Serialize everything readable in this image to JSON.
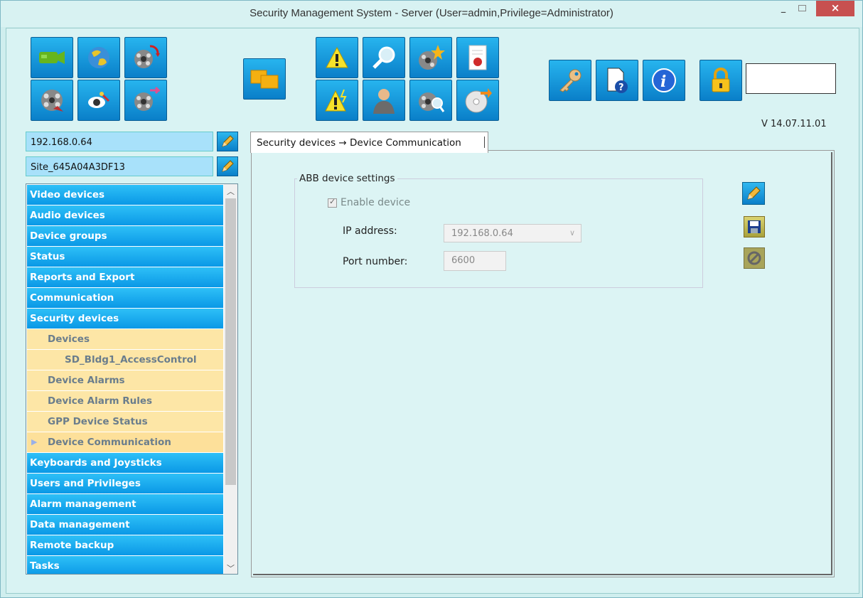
{
  "window": {
    "title": "Security Management System - Server (User=admin,Privilege=Administrator)",
    "min_glyph": "–",
    "close_glyph": "×"
  },
  "toolbar": {
    "icons": [
      "camera-icon",
      "globe-icon",
      "film-refresh-icon",
      "film-reel-icon",
      "eye-icon",
      "film-send-icon",
      "windows-icon",
      "warning-icon",
      "search-icon",
      "film-star-icon",
      "report-icon",
      "warning-flash-icon",
      "user-icon",
      "film-search-icon",
      "disc-export-icon",
      "key-icon",
      "help-doc-icon",
      "info-icon",
      "lock-icon"
    ],
    "lock_field_value": ""
  },
  "version": "V 14.07.11.01",
  "server": {
    "ip": "192.168.0.64",
    "site": "Site_645A04A3DF13"
  },
  "nav": {
    "items": [
      {
        "label": "Video devices",
        "level": 0
      },
      {
        "label": "Audio devices",
        "level": 0
      },
      {
        "label": "Device groups",
        "level": 0
      },
      {
        "label": "Status",
        "level": 0
      },
      {
        "label": "Reports and Export",
        "level": 0
      },
      {
        "label": "Communication",
        "level": 0
      },
      {
        "label": "Security devices",
        "level": 0
      },
      {
        "label": "Devices",
        "level": 1
      },
      {
        "label": "SD_Bldg1_AccessControl",
        "level": 2
      },
      {
        "label": "Device Alarms",
        "level": 1
      },
      {
        "label": "Device Alarm Rules",
        "level": 1
      },
      {
        "label": "GPP Device Status",
        "level": 1
      },
      {
        "label": "Device Communication",
        "level": 1,
        "selected": true
      },
      {
        "label": "Keyboards and Joysticks",
        "level": 0
      },
      {
        "label": "Users and Privileges",
        "level": 0
      },
      {
        "label": "Alarm management",
        "level": 0
      },
      {
        "label": "Data management",
        "level": 0
      },
      {
        "label": "Remote backup",
        "level": 0
      },
      {
        "label": "Tasks",
        "level": 0
      }
    ]
  },
  "tab": {
    "label": "Security devices → Device Communication"
  },
  "settings": {
    "group_title": "ABB device settings",
    "enable_label": "Enable device",
    "enable_checked": true,
    "ip_label": "IP address:",
    "ip_value": "192.168.0.64",
    "port_label": "Port number:",
    "port_value": "6600"
  },
  "colors": {
    "nav_blue": "#0a98e6",
    "nav_yellow": "#fde6a6",
    "close_red": "#c75050",
    "background": "#d9f3f3"
  }
}
